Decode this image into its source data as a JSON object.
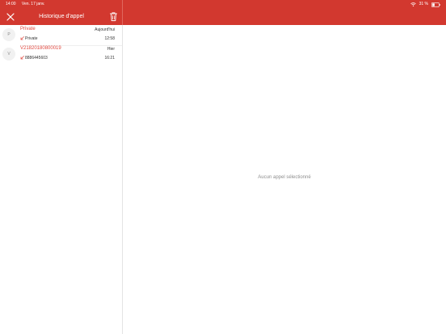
{
  "status_bar": {
    "time": "14:00",
    "date": "Ven. 17 janv.",
    "battery": "31 %",
    "icons": [
      "wifi-icon",
      "battery-icon"
    ]
  },
  "header": {
    "title": "Historique d'appel",
    "close_icon": "close-icon",
    "trash_icon": "trash-icon"
  },
  "calls": [
    {
      "avatar": "P",
      "name": "Private",
      "day": "Aujourd'hui",
      "number": "Private",
      "time": "12:58",
      "direction_icon": "incoming-call-icon"
    },
    {
      "avatar": "V",
      "name": "V21820180800019",
      "day": "Hier",
      "number": "8886445603",
      "time": "16:21",
      "direction_icon": "incoming-call-icon"
    }
  ],
  "detail": {
    "empty_text": "Aucun appel sélectionné"
  },
  "colors": {
    "accent": "#d2382f",
    "caller_name": "#e0483f",
    "avatar_bg": "#f1f1f1",
    "muted_text": "#8e8e8e"
  }
}
